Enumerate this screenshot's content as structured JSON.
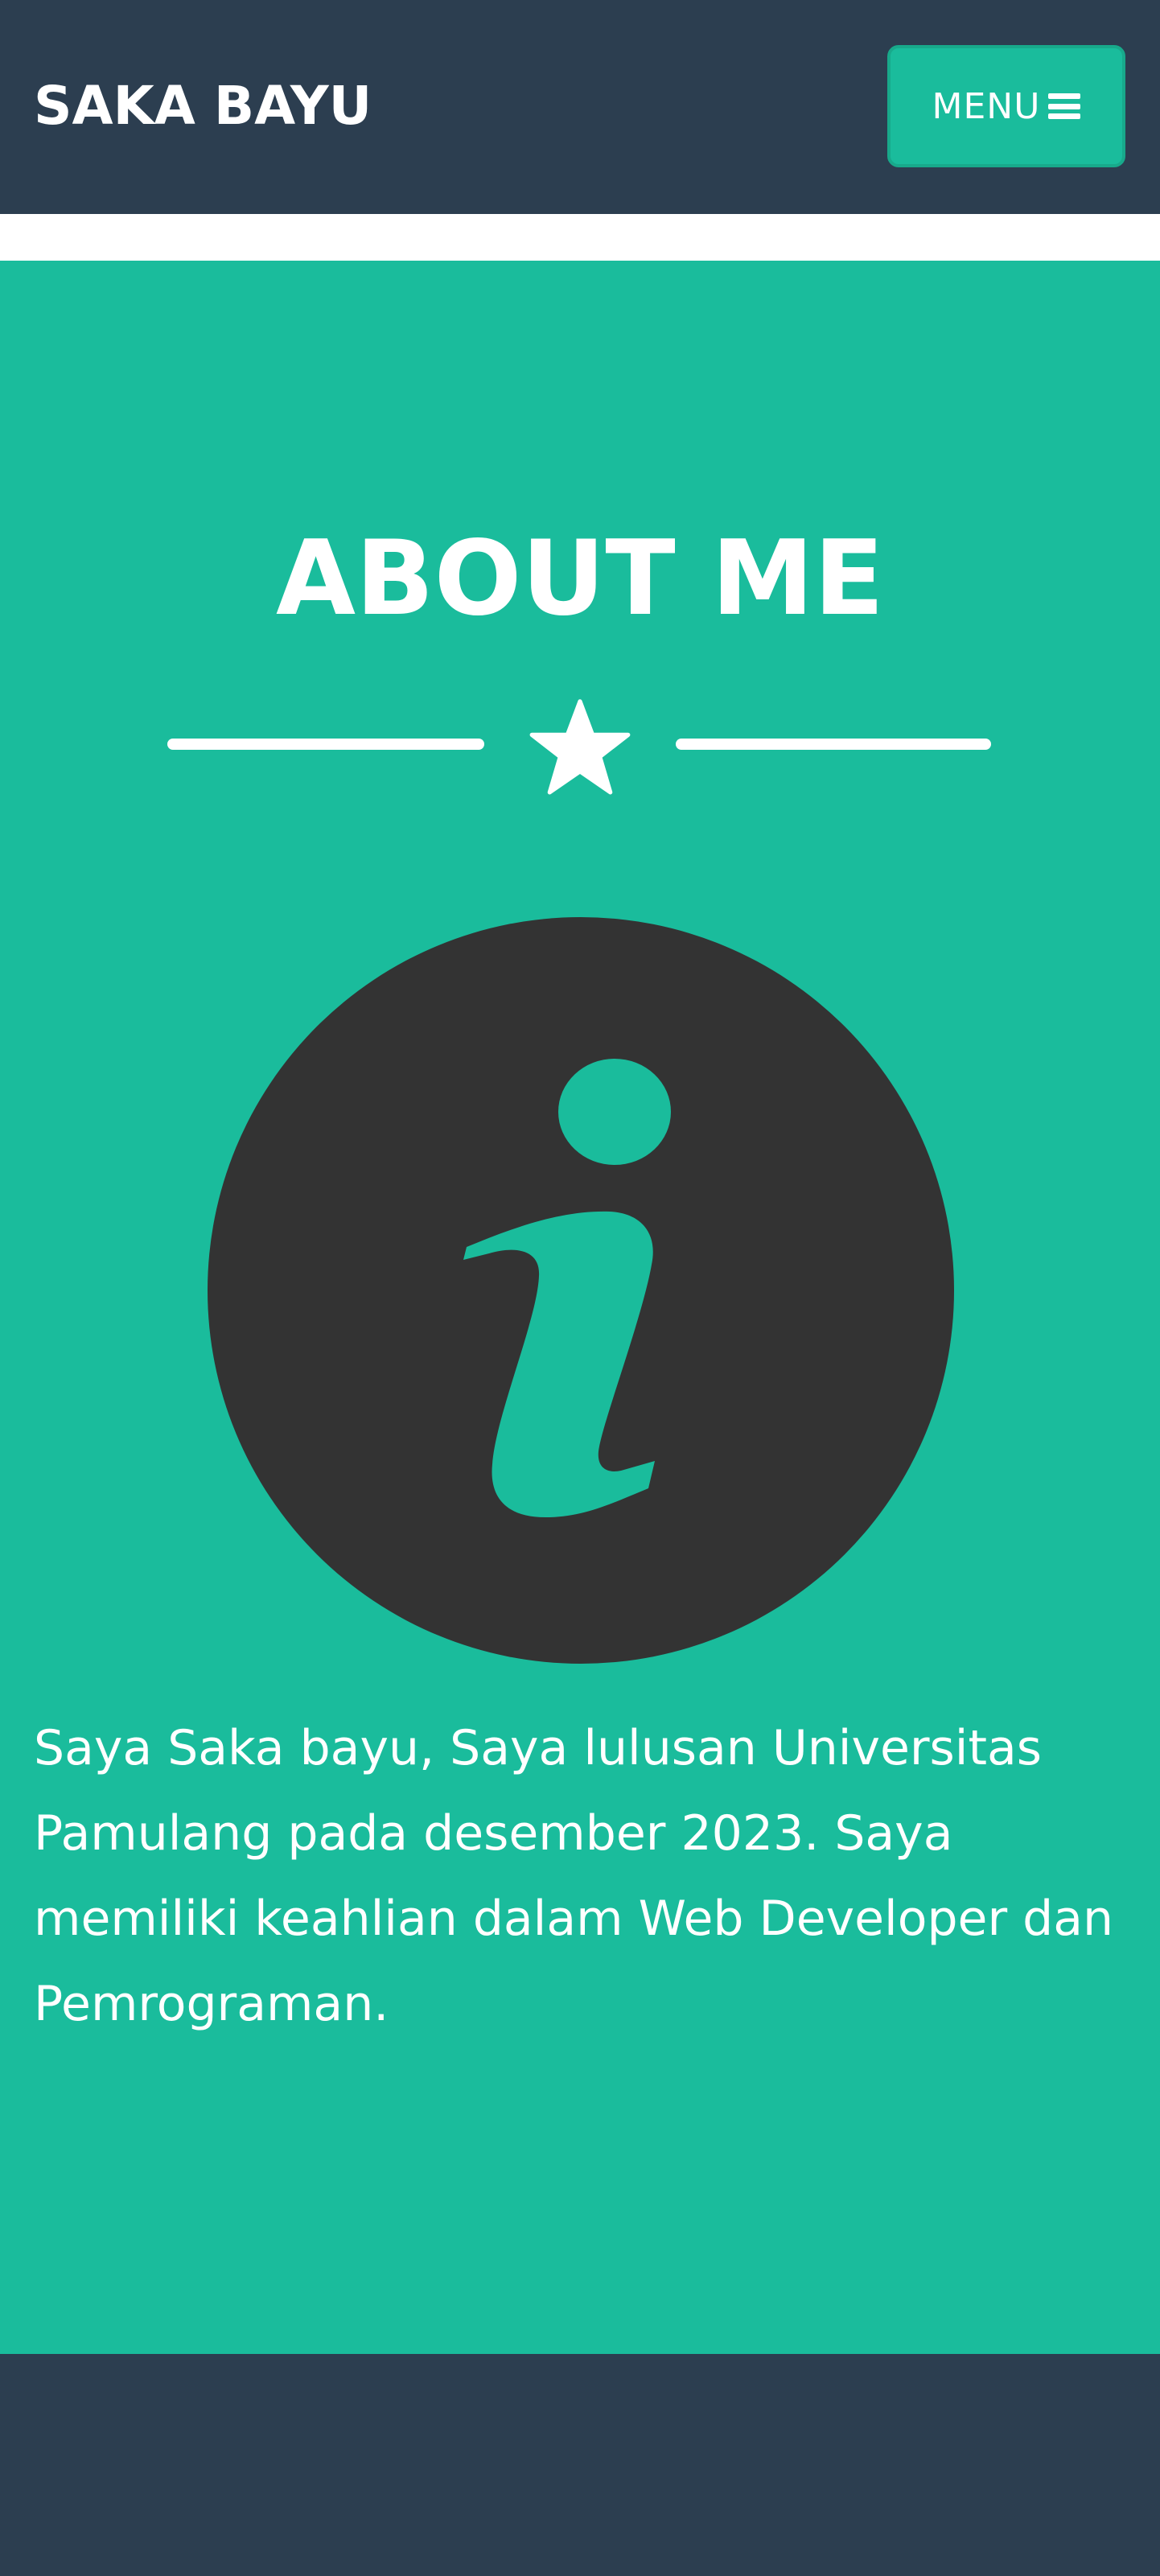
{
  "navbar": {
    "brand": "SAKA BAYU",
    "menu_label": "MENU",
    "menu_icon": "hamburger-icon"
  },
  "about": {
    "title": "ABOUT ME",
    "divider_icon": "star-icon",
    "image_icon": "info-icon",
    "text": "Saya Saka bayu, Saya lulusan Universitas Pamulang pada desember 2023. Saya memiliki keahlian dalam Web Developer dan Pemrograman."
  },
  "colors": {
    "navy": "#2c3e50",
    "teal": "#1abc9c",
    "dark_circle": "#333333",
    "white": "#ffffff"
  }
}
